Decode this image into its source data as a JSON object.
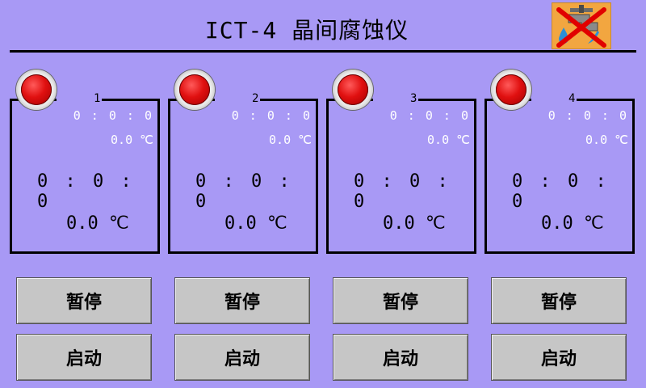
{
  "header": {
    "title": "ICT-4 晶间腐蚀仪"
  },
  "channels": [
    {
      "number": "1",
      "set_time": "0 : 0 : 0",
      "set_temp": "0.0 ℃",
      "time": "0 : 0 : 0",
      "temp": "0.0 ℃",
      "pause_label": "暂停",
      "start_label": "启动"
    },
    {
      "number": "2",
      "set_time": "0 : 0 : 0",
      "set_temp": "0.0 ℃",
      "time": "0 : 0 : 0",
      "temp": "0.0 ℃",
      "pause_label": "暂停",
      "start_label": "启动"
    },
    {
      "number": "3",
      "set_time": "0 : 0 : 0",
      "set_temp": "0.0 ℃",
      "time": "0 : 0 : 0",
      "temp": "0.0 ℃",
      "pause_label": "暂停",
      "start_label": "启动"
    },
    {
      "number": "4",
      "set_time": "0 : 0 : 0",
      "set_temp": "0.0 ℃",
      "time": "0 : 0 : 0",
      "temp": "0.0 ℃",
      "pause_label": "暂停",
      "start_label": "启动"
    }
  ],
  "icons": {
    "logo": "faucet-icon",
    "lamp": "status-lamp-icon"
  },
  "colors": {
    "background": "#a899f5",
    "lamp": "#e01010",
    "button": "#c6c6c6",
    "small_text": "#ffffff"
  }
}
